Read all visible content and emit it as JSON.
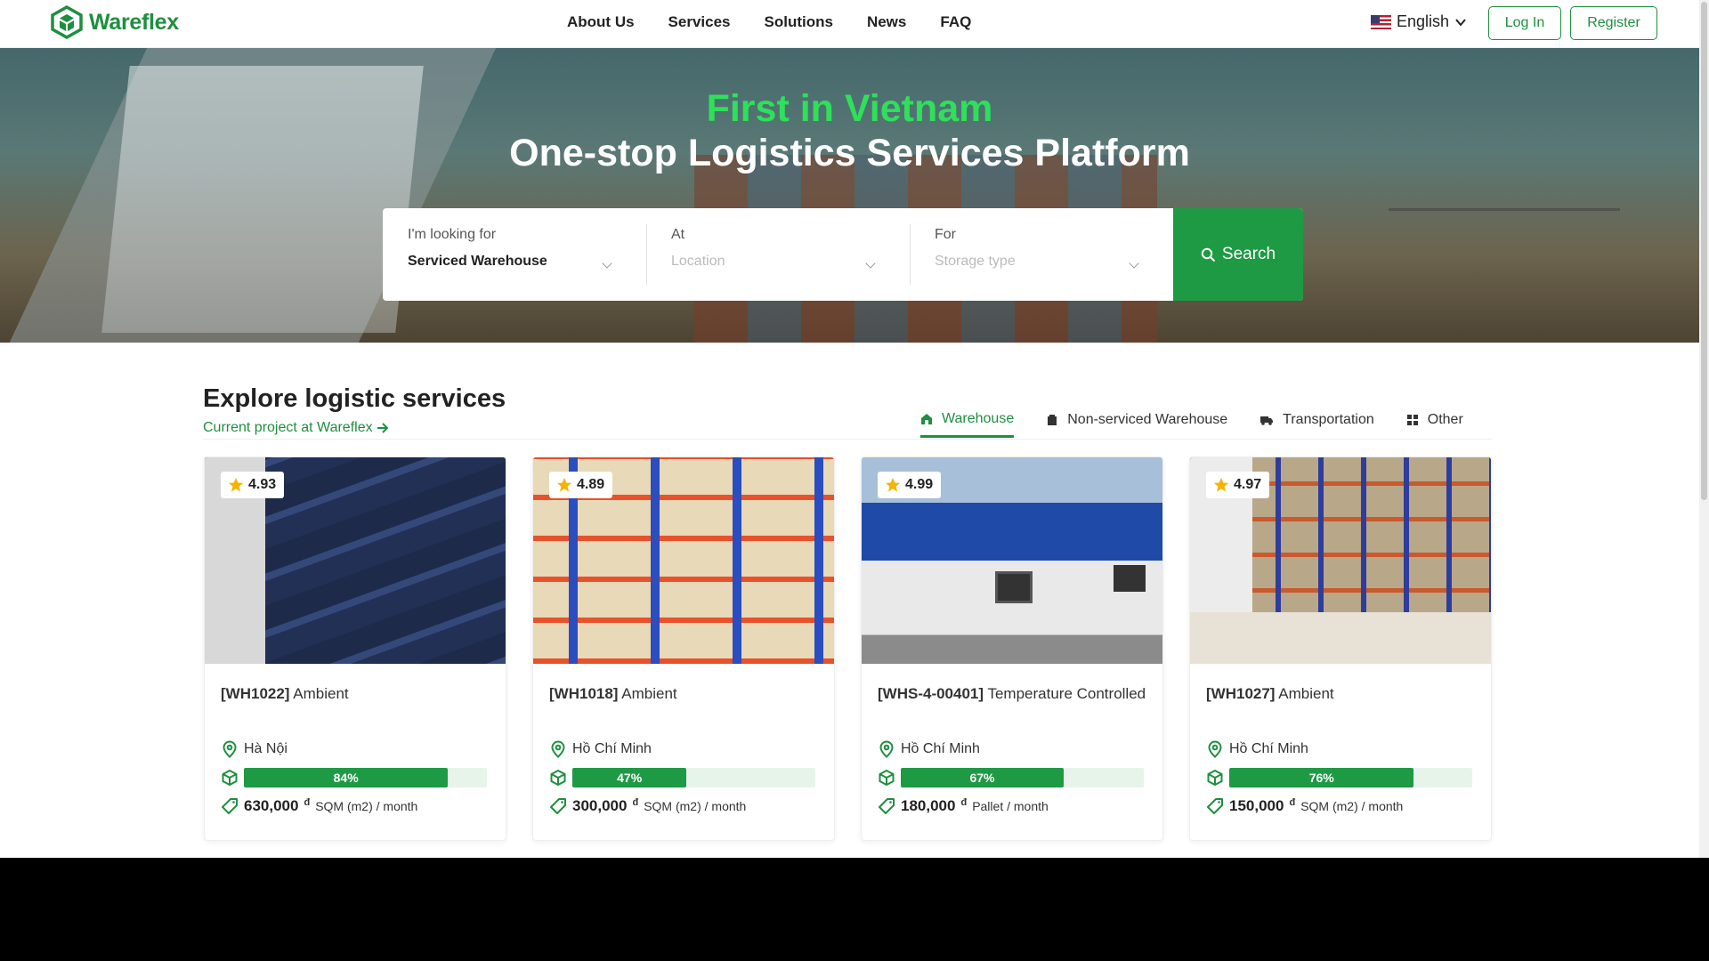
{
  "brand": {
    "name": "Wareflex",
    "color": "#1e8f3e"
  },
  "nav": [
    {
      "label": "About Us"
    },
    {
      "label": "Services"
    },
    {
      "label": "Solutions"
    },
    {
      "label": "News"
    },
    {
      "label": "FAQ"
    }
  ],
  "header": {
    "language": "English",
    "login_label": "Log In",
    "register_label": "Register"
  },
  "hero": {
    "title_highlight": "First in Vietnam",
    "title": "One-stop Logistics Services Platform",
    "search": {
      "looking_label": "I'm looking for",
      "looking_value": "Serviced Warehouse",
      "at_label": "At",
      "at_placeholder": "Location",
      "for_label": "For",
      "for_placeholder": "Storage type",
      "button_label": "Search"
    }
  },
  "explore": {
    "title": "Explore logistic services",
    "link": "Current project at Wareflex",
    "tabs": [
      {
        "label": "Warehouse",
        "icon": "home-icon",
        "active": true
      },
      {
        "label": "Non-serviced Warehouse",
        "icon": "building-icon",
        "active": false
      },
      {
        "label": "Transportation",
        "icon": "truck-icon",
        "active": false
      },
      {
        "label": "Other",
        "icon": "grid-icon",
        "active": false
      }
    ],
    "cards": [
      {
        "rating": "4.93",
        "code": "[WH1022]",
        "type": "Ambient",
        "location": "Hà Nội",
        "occupancy": 84,
        "occupancy_label": "84%",
        "price": "630,000",
        "currency": "đ",
        "unit": "SQM (m2) / month"
      },
      {
        "rating": "4.89",
        "code": "[WH1018]",
        "type": "Ambient",
        "location": "Hồ Chí Minh",
        "occupancy": 47,
        "occupancy_label": "47%",
        "price": "300,000",
        "currency": "đ",
        "unit": "SQM (m2) / month"
      },
      {
        "rating": "4.99",
        "code": "[WHS-4-00401]",
        "type": "Temperature Controlled",
        "location": "Hồ Chí Minh",
        "occupancy": 67,
        "occupancy_label": "67%",
        "price": "180,000",
        "currency": "đ",
        "unit": "Pallet / month"
      },
      {
        "rating": "4.97",
        "code": "[WH1027]",
        "type": "Ambient",
        "location": "Hồ Chí Minh",
        "occupancy": 76,
        "occupancy_label": "76%",
        "price": "150,000",
        "currency": "đ",
        "unit": "SQM (m2) / month"
      }
    ]
  }
}
